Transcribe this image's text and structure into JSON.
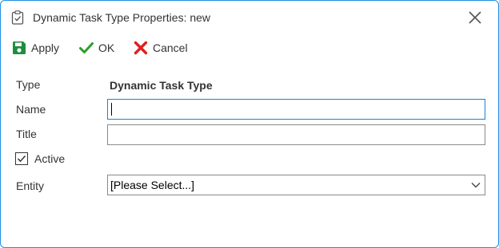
{
  "window": {
    "title": "Dynamic Task Type Properties: new",
    "title_icon": "clipboard-check-icon",
    "close_icon": "close-icon"
  },
  "toolbar": {
    "apply_label": "Apply",
    "apply_icon": "floppy-disk-icon",
    "ok_label": "OK",
    "ok_icon": "checkmark-icon",
    "cancel_label": "Cancel",
    "cancel_icon": "x-cross-icon"
  },
  "form": {
    "type_label": "Type",
    "type_value": "Dynamic Task Type",
    "name_label": "Name",
    "name_value": "",
    "title_label": "Title",
    "title_value": "",
    "active_label": "Active",
    "active_checked": true,
    "entity_label": "Entity",
    "entity_value": "[Please Select...]"
  },
  "colors": {
    "window_border": "#1e90e6",
    "focus_border": "#1e7fd6",
    "apply_green": "#1e8e3e",
    "ok_green": "#2e9e2e",
    "cancel_red": "#e01e1e"
  }
}
